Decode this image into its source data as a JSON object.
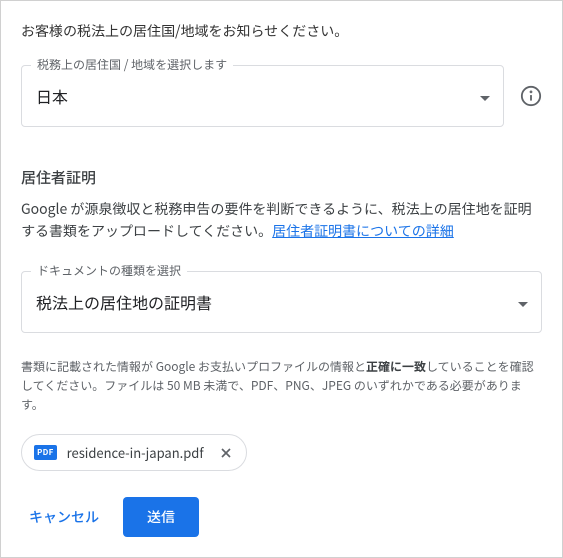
{
  "heading": "お客様の税法上の居住国/地域をお知らせください。",
  "country_select": {
    "label": "税務上の居住国 / 地域を選択します",
    "value": "日本"
  },
  "section_title": "居住者証明",
  "description_part1": "Google が源泉徴収と税務申告の要件を判断できるように、税法上の居住地を証明する書類をアップロードしてください。",
  "description_link": "居住者証明書についての詳細",
  "doc_select": {
    "label": "ドキュメントの種類を選択",
    "value": "税法上の居住地の証明書"
  },
  "instructions_part1": "書類に記載された情報が Google お支払いプロファイルの情報と",
  "instructions_bold": "正確に一致",
  "instructions_part2": "していることを確認してください。ファイルは 50 MB 未満で、PDF、PNG、JPEG のいずれかである必要があります。",
  "file": {
    "badge": "PDF",
    "name": "residence-in-japan.pdf"
  },
  "footer": {
    "cancel": "キャンセル",
    "submit": "送信"
  }
}
